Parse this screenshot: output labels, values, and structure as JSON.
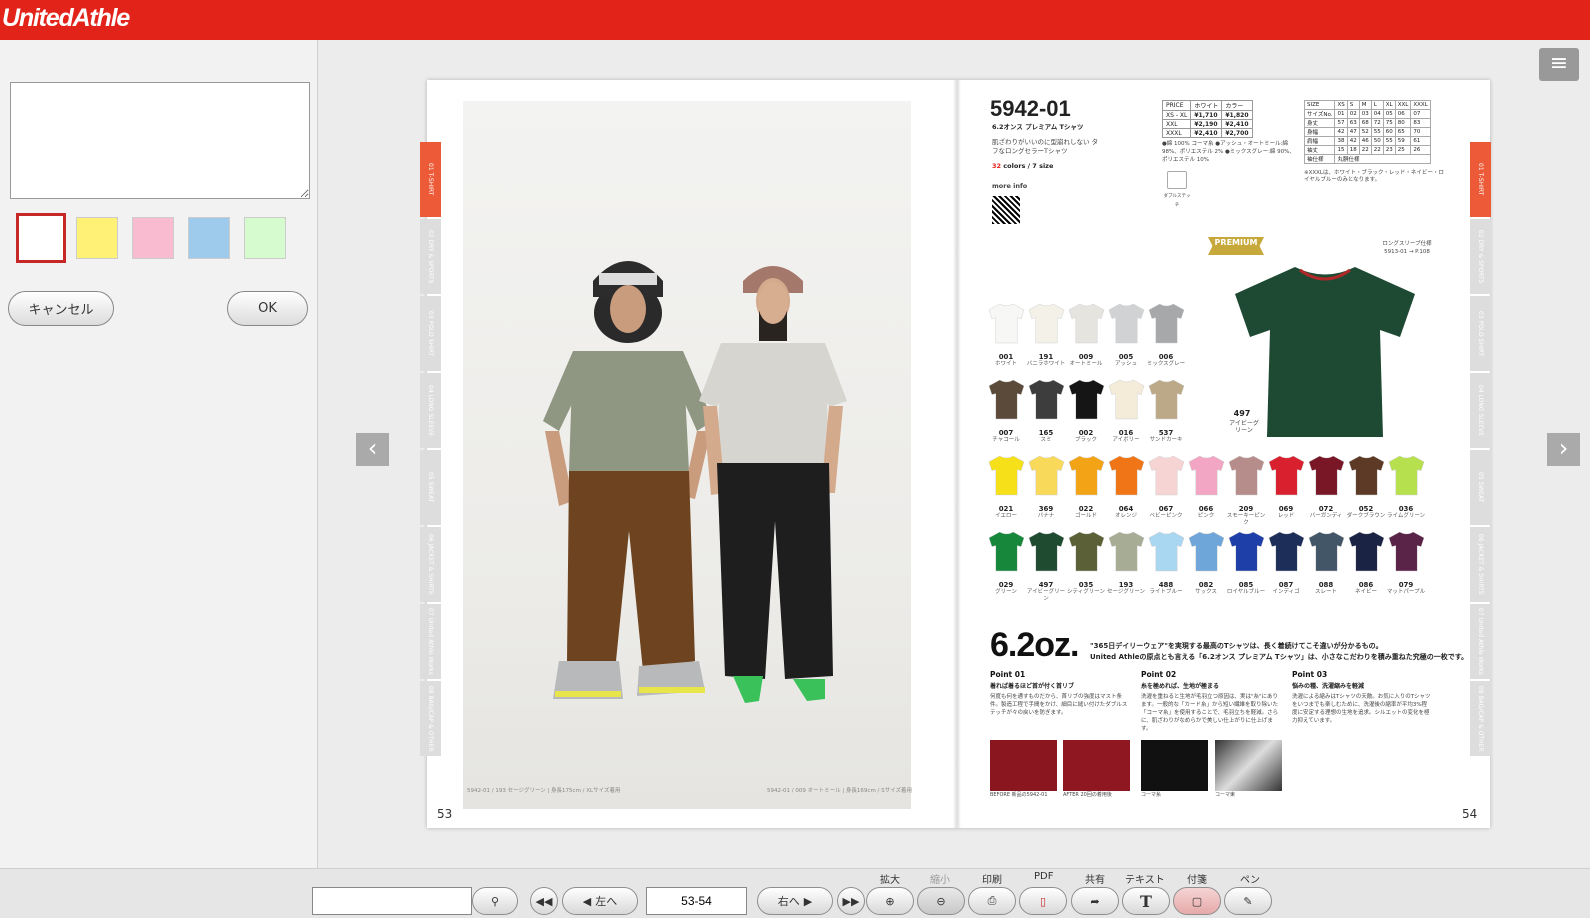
{
  "header": {
    "logo": "UnitedAthle"
  },
  "left_panel": {
    "memo_value": "",
    "swatches": [
      "#ffffff",
      "#fff176",
      "#f8bbd0",
      "#9ecbeb",
      "#d5fbcf"
    ],
    "selected_swatch": 0,
    "cancel_label": "キャンセル",
    "ok_label": "OK"
  },
  "book": {
    "left_page_number": "53",
    "right_page_number": "54",
    "left_caption_1": "5942-01 / 193 セージグリーン | 身長175cm / XLサイズ着用",
    "left_caption_2": "5942-01 / 009 オートミール | 身長169cm / Sサイズ着用",
    "tabs": [
      "01 T-SHIRT",
      "02 DRY & SPORTS",
      "03 POLO SHIRT",
      "04 LONG SLEEVE",
      "05 SWEAT",
      "06 JACKET & SHIRTS",
      "07 United Athle Works",
      "08 BAG/CAP & OTHER"
    ],
    "product_code": "5942-01",
    "product_name": "6.2オンス プレミアム Tシャツ",
    "product_desc": "肌ざわりがいいのに型崩れしない タフなロングセラーTシャツ",
    "colors_size": "32 colors / 7 size",
    "more_info": "more info",
    "price_table": [
      [
        "PRICE",
        "ホワイト",
        "カラー"
      ],
      [
        "XS - XL",
        "¥1,710",
        "¥1,820"
      ],
      [
        "XXL",
        "¥2,190",
        "¥2,410"
      ],
      [
        "XXXL",
        "¥2,410",
        "¥2,700"
      ]
    ],
    "material_notes": "●綿 100% コーマ糸 ●アッシュ・オートミール:綿 98%、ポリエステル 2% ●ミックスグレー:綿 90%、ポリエステル 10%",
    "size_table": [
      [
        "SIZE",
        "XS",
        "S",
        "M",
        "L",
        "XL",
        "XXL",
        "XXXL"
      ],
      [
        "サイズNo.",
        "01",
        "02",
        "03",
        "04",
        "05",
        "06",
        "07"
      ],
      [
        "身丈",
        "57",
        "63",
        "68",
        "72",
        "75",
        "80",
        "83"
      ],
      [
        "身幅",
        "42",
        "47",
        "52",
        "55",
        "60",
        "65",
        "70"
      ],
      [
        "肩幅",
        "38",
        "42",
        "46",
        "50",
        "55",
        "59",
        "61"
      ],
      [
        "袖丈",
        "15",
        "18",
        "22",
        "22",
        "23",
        "25",
        "26"
      ],
      [
        "袖仕様",
        "丸胴仕様"
      ]
    ],
    "size_note": "※XXXLは、ホワイト・ブラック・レッド・ネイビー・ロイヤルブルーのみとなります。",
    "double_stitch": "ダブルステッチ",
    "badge": "PREMIUM",
    "cross_ref": "ロングスリーブ仕様 5913-01 → P.108",
    "featured": {
      "code": "497",
      "name": "アイビーグリーン",
      "color": "#1e4a33"
    },
    "swatches": [
      {
        "code": "001",
        "name": "ホワイト",
        "color": "#f7f7f5"
      },
      {
        "code": "191",
        "name": "バニラホワイト",
        "color": "#f4f1e8"
      },
      {
        "code": "009",
        "name": "オートミール",
        "color": "#e6e4df"
      },
      {
        "code": "005",
        "name": "アッシュ",
        "color": "#d1d2d3"
      },
      {
        "code": "006",
        "name": "ミックスグレー",
        "color": "#a6a8aa"
      },
      {
        "code": "007",
        "name": "チャコール",
        "color": "#5b4a3a"
      },
      {
        "code": "165",
        "name": "スミ",
        "color": "#3d3d3e"
      },
      {
        "code": "002",
        "name": "ブラック",
        "color": "#151515"
      },
      {
        "code": "016",
        "name": "アイボリー",
        "color": "#f4ecd8"
      },
      {
        "code": "537",
        "name": "サンドカーキ",
        "color": "#bca987"
      },
      {
        "code": "021",
        "name": "イエロー",
        "color": "#f6e01a"
      },
      {
        "code": "369",
        "name": "バナナ",
        "color": "#f8d95a"
      },
      {
        "code": "022",
        "name": "ゴールド",
        "color": "#f3a316"
      },
      {
        "code": "064",
        "name": "オレンジ",
        "color": "#ef7516"
      },
      {
        "code": "067",
        "name": "ベビーピンク",
        "color": "#f7d4d4"
      },
      {
        "code": "066",
        "name": "ピンク",
        "color": "#f2a6c3"
      },
      {
        "code": "209",
        "name": "スモーキーピンク",
        "color": "#b78d8b"
      },
      {
        "code": "069",
        "name": "レッド",
        "color": "#d8202e"
      },
      {
        "code": "072",
        "name": "バーガンディ",
        "color": "#7a1727"
      },
      {
        "code": "052",
        "name": "ダークブラウン",
        "color": "#5d3a25"
      },
      {
        "code": "036",
        "name": "ライムグリーン",
        "color": "#b6e04e"
      },
      {
        "code": "029",
        "name": "グリーン",
        "color": "#17873c"
      },
      {
        "code": "497",
        "name": "アイビーグリーン",
        "color": "#1f4b31"
      },
      {
        "code": "035",
        "name": "シティグリーン",
        "color": "#5b6036"
      },
      {
        "code": "193",
        "name": "セージグリーン",
        "color": "#a7ad94"
      },
      {
        "code": "488",
        "name": "ライトブルー",
        "color": "#a9d6f1"
      },
      {
        "code": "082",
        "name": "サックス",
        "color": "#6ea6d9"
      },
      {
        "code": "085",
        "name": "ロイヤルブルー",
        "color": "#1e3fa8"
      },
      {
        "code": "087",
        "name": "インディゴ",
        "color": "#1d2e59"
      },
      {
        "code": "088",
        "name": "スレート",
        "color": "#435667"
      },
      {
        "code": "086",
        "name": "ネイビー",
        "color": "#1a2344"
      },
      {
        "code": "079",
        "name": "マットパープル",
        "color": "#5a2348"
      }
    ],
    "oz": "6.2oz.",
    "oz_text_1": "\"365日デイリーウェア\"を実現する最高のTシャツは、長く着続けてこそ違いが分かるもの。",
    "oz_text_2": "United Athleの原点とも言える「6.2オンス プレミアム Tシャツ」は、小さなこだわりを積み重ねた究極の一枚です。",
    "points": [
      {
        "title": "Point 01",
        "sub": "着れば着るほど首が付く首リブ",
        "text": "何度も何を通すものだから、首リブの強度はマスト条件。製造工程で手間をかけ、細目に縫い付けたダブルステッチが々の戻いを防ぎます。"
      },
      {
        "title": "Point 02",
        "sub": "糸を極めれば、生地が極まる",
        "text": "洗濯を重ねると生地が毛羽立つ原因は、実は\"糸\"にあります。一般的な「カード糸」から短い繊維を取り除いた「コーマ糸」を使用することで、毛羽立ちを軽減。さらに、肌ざわりがなめらかで美しい仕上がりに仕上げます。"
      },
      {
        "title": "Point 03",
        "sub": "悩みの種、洗濯縮みを軽減",
        "text": "洗濯による縮みはTシャツの天敵。お気に入りのTシャツをいつまでも楽しむために、洗濯後の縮率が平均3%程度に安定する理想の生地を追求。シルエットの変化を極力抑えています。"
      }
    ],
    "thumb_labels": [
      "BEFORE 新品の5942-01",
      "AFTER 20回の着用後",
      "コーマ糸",
      "コーマ束"
    ]
  },
  "toolbar": {
    "search_value": "",
    "prev_label": "左へ",
    "page_value": "53-54",
    "next_label": "右へ",
    "zoom_in": "拡大",
    "zoom_out": "縮小",
    "print": "印刷",
    "pdf": "PDF",
    "share": "共有",
    "text": "テキスト",
    "sticky": "付箋",
    "pen": "ペン"
  }
}
